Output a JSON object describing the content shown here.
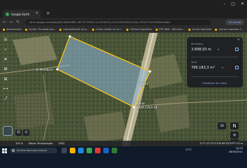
{
  "browser": {
    "tab_title": "Google Earth",
    "new_tab": "+",
    "window_controls": {
      "minimize": "–",
      "maximize": "□",
      "close": "✕"
    },
    "url": "earth.google.com/web/@20.86454803,-89.70710394,12.1976157a,2514.60549102d,35y,319.67741019h0t0r/data",
    "profile": "Sin pausar",
    "bookmarks": [
      "Aplicaciones",
      "Correo: Ocuwatt pen...",
      "Interpretación de p...",
      "Iniciar sesión en la c...",
      "Ofertas Argentina",
      "OTE Web - Beneme...",
      "Correo Isaelante",
      "Correo: Isabanta 1...",
      "Correo: Isabanta 1..."
    ]
  },
  "map": {
    "labels": {
      "place_left": "El Membora",
      "place_center": "Cabo1",
      "place_bottom": "Granja",
      "place_bottom_sub": "YASSA CACA 18"
    },
    "polygon_color": "#f5c518"
  },
  "measure_panel": {
    "perimeter_label": "Perímetro",
    "perimeter_value": "3.898,93 m",
    "perimeter_unit_sub": "▾",
    "area_label": "Área",
    "area_value": "786.183,3 m²",
    "area_unit_sub": "▾",
    "restart_label": "Comenzar de nuevo",
    "close": "✕"
  },
  "controls": {
    "zoom_in": "+",
    "zoom_out": "−",
    "view_3d": "3D",
    "compass": "N"
  },
  "status": {
    "scale": "100 %",
    "provider": "Maxar Technologies",
    "year": "2020",
    "right": "27°C  22°32'13\"N  89°43'39\"O  23 m"
  },
  "taskbar": {
    "search_placeholder": "Escribe aquí para buscar",
    "weather": "27°C",
    "time": "14:23",
    "date": "26/05/2021"
  }
}
